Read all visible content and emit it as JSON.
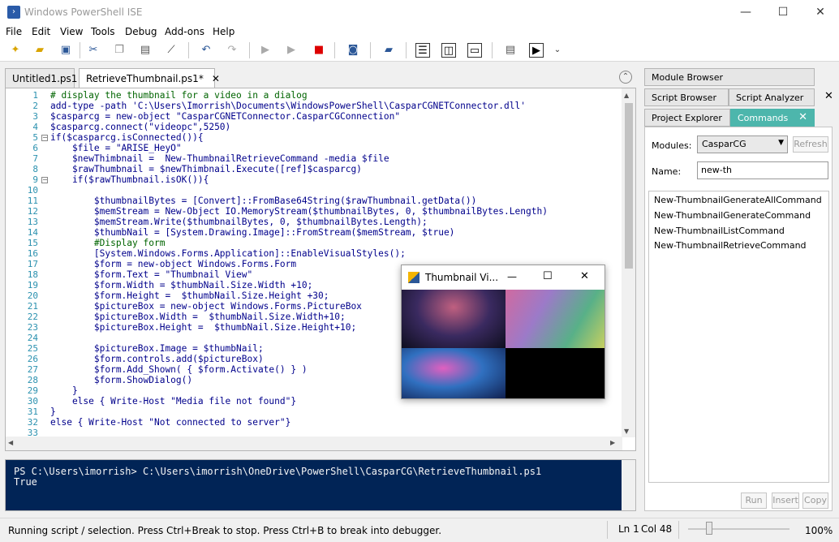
{
  "window": {
    "title": "Windows PowerShell ISE",
    "min": "—",
    "max": "☐",
    "close": "✕"
  },
  "menu": [
    "File",
    "Edit",
    "View",
    "Tools",
    "Debug",
    "Add-ons",
    "Help"
  ],
  "tabs": [
    {
      "label": "Untitled1.ps1"
    },
    {
      "label": "RetrieveThumbnail.ps1*",
      "close": "✕"
    }
  ],
  "code_lines": [
    "# display the thumbnail for a video in a dialog",
    "add-type -path 'C:\\Users\\Imorrish\\Documents\\WindowsPowerShell\\CasparCGNETConnector.dll'",
    "$casparcg = new-object \"CasparCGNETConnector.CasparCGConnection\"",
    "$casparcg.connect(\"videopc\",5250)",
    "if($casparcg.isConnected()){",
    "    $file = \"ARISE_HeyO\"",
    "    $newThimbnail =  New-ThumbnailRetrieveCommand -media $file",
    "    $rawThumbnail = $newThimbnail.Execute([ref]$casparcg)",
    "    if($rawThumbnail.isOK()){",
    "",
    "        $thumbnailBytes = [Convert]::FromBase64String($rawThumbnail.getData())",
    "        $memStream = New-Object IO.MemoryStream($thumbnailBytes, 0, $thumbnailBytes.Length)",
    "        $memStream.Write($thumbnailBytes, 0, $thumbnailBytes.Length);",
    "        $thumbNail = [System.Drawing.Image]::FromStream($memStream, $true)",
    "        #Display form",
    "        [System.Windows.Forms.Application]::EnableVisualStyles();",
    "        $form = new-object Windows.Forms.Form",
    "        $form.Text = \"Thumbnail View\"",
    "        $form.Width = $thumbNail.Size.Width +10;",
    "        $form.Height =  $thumbNail.Size.Height +30;",
    "        $pictureBox = new-object Windows.Forms.PictureBox",
    "        $pictureBox.Width =  $thumbNail.Size.Width+10;",
    "        $pictureBox.Height =  $thumbNail.Size.Height+10;",
    "",
    "        $pictureBox.Image = $thumbNail;",
    "        $form.controls.add($pictureBox)",
    "        $form.Add_Shown( { $form.Activate() } )",
    "        $form.ShowDialog()",
    "    }",
    "    else { Write-Host \"Media file not found\"}",
    "}",
    "else { Write-Host \"Not connected to server\"}",
    ""
  ],
  "line_numbers": [
    "1",
    "2",
    "3",
    "4",
    "5",
    "6",
    "7",
    "8",
    "9",
    "10",
    "11",
    "12",
    "13",
    "14",
    "15",
    "16",
    "17",
    "18",
    "19",
    "20",
    "21",
    "22",
    "23",
    "24",
    "25",
    "26",
    "27",
    "28",
    "29",
    "30",
    "31",
    "32",
    "33"
  ],
  "console": {
    "prompt": "PS C:\\Users\\imorrish> C:\\Users\\imorrish\\OneDrive\\PowerShell\\CasparCG\\RetrieveThumbnail.ps1",
    "output": "True"
  },
  "status": {
    "message": "Running script / selection.  Press Ctrl+Break to stop.  Press Ctrl+B to break into debugger.",
    "ln": "Ln 1",
    "col": "Col 48",
    "zoom": "100%"
  },
  "right": {
    "tabs_row1": [
      "Module Browser"
    ],
    "tabs_row2": [
      "Script Browser",
      "Script Analyzer"
    ],
    "tabs_row3": [
      "Project Explorer",
      "Commands"
    ],
    "modules_label": "Modules:",
    "modules_value": "CasparCG",
    "refresh": "Refresh",
    "name_label": "Name:",
    "name_value": "new-th",
    "commands": [
      "New-ThumbnailGenerateAllCommand",
      "New-ThumbnailGenerateCommand",
      "New-ThumbnailListCommand",
      "New-ThumbnailRetrieveCommand"
    ],
    "run": "Run",
    "insert": "Insert",
    "copy": "Copy",
    "close": "✕"
  },
  "popup": {
    "title": "Thumbnail Vi...",
    "min": "—",
    "max": "☐",
    "close": "✕"
  }
}
